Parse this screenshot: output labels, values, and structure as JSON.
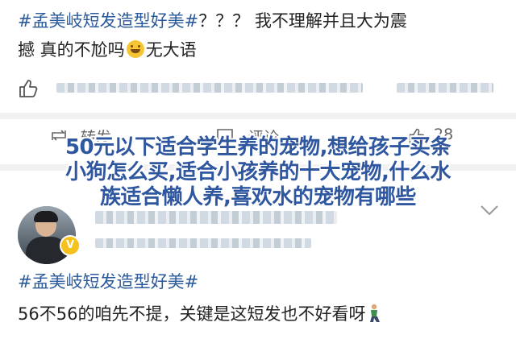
{
  "post1": {
    "hashtag": "#孟美岐短发造型好美#",
    "line1_text": "？？？ 我不理解并且大为震",
    "line2_text": "撼 真的不尬吗",
    "line2_after_emoji": "无大语",
    "emoji": "grin-sweat-emoji"
  },
  "actions": {
    "repost_label": "转发",
    "comment_label": "评论",
    "like_count": "28"
  },
  "overlay_title": {
    "line1": "50元以下适合学生养的宠物,想给孩子买条",
    "line2": "小狗怎么买,适合小孩养的十大宠物,什么水",
    "line3": "族适合懒人养,喜欢水的宠物有哪些"
  },
  "post2": {
    "verified_badge": "V",
    "hashtag": "#孟美岐短发造型好美#",
    "text": "56不56的咱先不提，关键是这短发也不好看呀",
    "emoji": "person-kneeling-emoji"
  },
  "colors": {
    "hashtag": "#2b5a9c",
    "overlay_text": "#2f57a0",
    "badge": "#f5c21b"
  }
}
